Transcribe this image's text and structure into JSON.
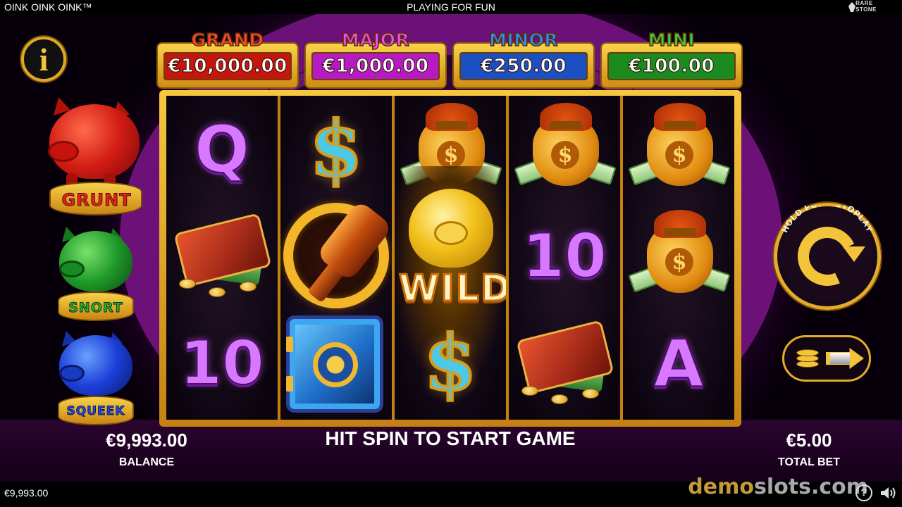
{
  "header": {
    "game_title": "OINK OINK OINK™",
    "mode": "PLAYING FOR FUN",
    "provider_logo": "RARE STONE",
    "provider_logo_line1": "RARE",
    "provider_logo_line2": "STONE"
  },
  "info_button": {
    "icon": "i"
  },
  "pigs": [
    {
      "label": "GRUNT",
      "color": "#d21c14"
    },
    {
      "label": "SNORT",
      "color": "#1f9a2a"
    },
    {
      "label": "SQUEEK",
      "color": "#1c3fd8"
    }
  ],
  "jackpots": [
    {
      "name": "GRAND",
      "value": "€10,000.00",
      "name_color": "#ff4a2a",
      "box_color": "#c4160e"
    },
    {
      "name": "MAJOR",
      "value": "€1,000.00",
      "name_color": "#f04ae8",
      "box_color": "#b71ac2"
    },
    {
      "name": "MINOR",
      "value": "€250.00",
      "name_color": "#2a8ff0",
      "box_color": "#1c4fc2"
    },
    {
      "name": "MINI",
      "value": "€100.00",
      "name_color": "#3ccf3c",
      "box_color": "#1b8a1f"
    }
  ],
  "reels": [
    [
      "Q",
      "wallet",
      "10"
    ],
    [
      "dollar",
      "hammer",
      "safe"
    ],
    [
      "money-bag",
      "wild",
      "dollar"
    ],
    [
      "money-bag",
      "10",
      "wallet"
    ],
    [
      "money-bag",
      "money-bag",
      "A"
    ]
  ],
  "reel_text": {
    "q": "Q",
    "ten_a": "10",
    "ten_b": "10",
    "a": "A",
    "dollar": "$",
    "wild": "WILD"
  },
  "message": "HIT SPIN TO START GAME",
  "balance": {
    "value": "€9,993.00",
    "label": "BALANCE"
  },
  "total_bet": {
    "value": "€5.00",
    "label": "TOTAL BET"
  },
  "spin_button": {
    "label": "HOLD FOR AUTOPLAY"
  },
  "status_bar": {
    "balance": "€9,993.00",
    "help": "?"
  },
  "watermark": {
    "part1": "demo",
    "part2": "slots.com"
  },
  "colors": {
    "gold": "#f3c33a",
    "purple_bg": "#3d0748"
  }
}
